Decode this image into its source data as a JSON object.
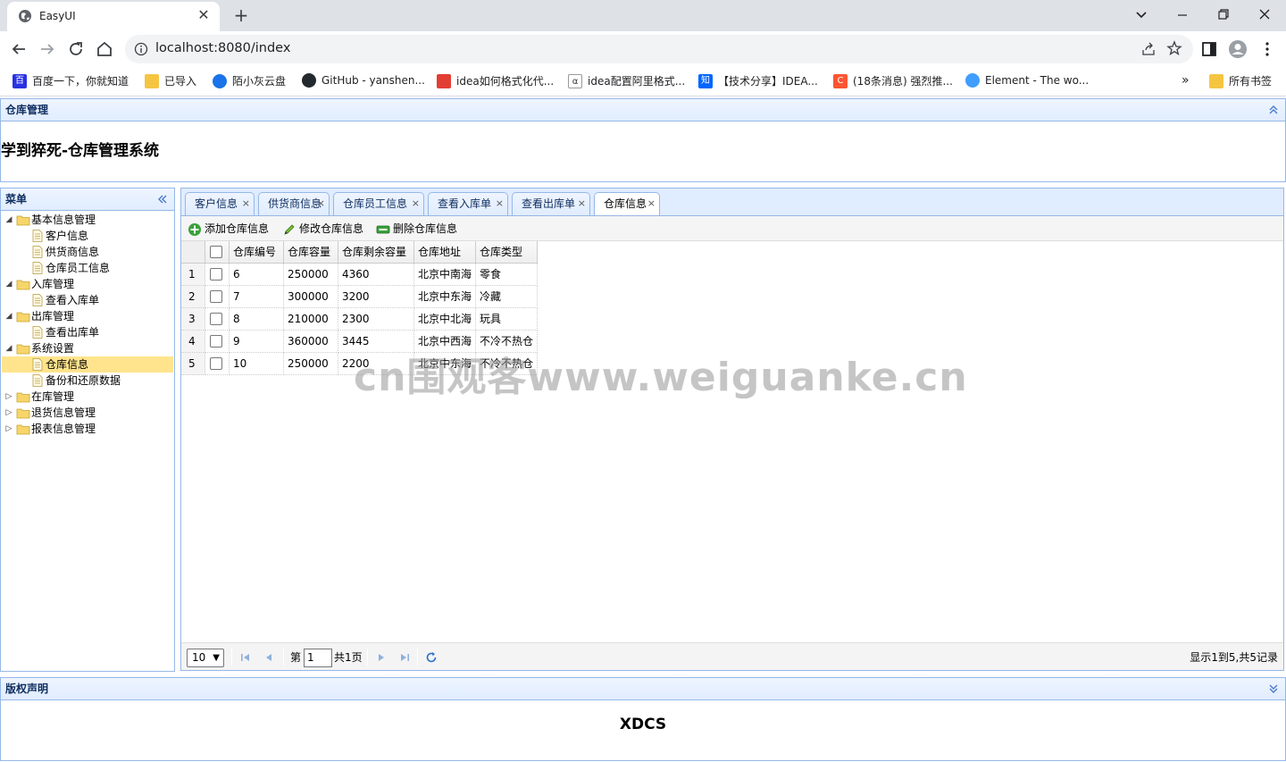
{
  "browser": {
    "tab_title": "EasyUI",
    "url": "localhost:8080/index",
    "bookmarks": [
      {
        "label": "百度一下，你就知道",
        "icon": "baidu-icon"
      },
      {
        "label": "已导入",
        "icon": "folder-icon"
      },
      {
        "label": "陌小灰云盘",
        "icon": "cloud-icon"
      },
      {
        "label": "GitHub - yanshen...",
        "icon": "github-icon"
      },
      {
        "label": "idea如何格式化代...",
        "icon": "csdn-icon"
      },
      {
        "label": "idea配置阿里格式...",
        "icon": "ali-icon"
      },
      {
        "label": "【技术分享】IDEA...",
        "icon": "zhihu-icon"
      },
      {
        "label": "(18条消息) 强烈推...",
        "icon": "csdn-c-icon"
      },
      {
        "label": "Element - The wo...",
        "icon": "element-icon"
      }
    ],
    "more_bookmarks": "»",
    "all_bookmarks": "所有书签"
  },
  "north": {
    "panel_title": "仓库管理",
    "system_title": "学到猝死-仓库管理系统"
  },
  "west": {
    "panel_title": "菜单",
    "tree": [
      {
        "label": "基本信息管理",
        "level": 0,
        "folder": true,
        "open": true
      },
      {
        "label": "客户信息",
        "level": 1,
        "folder": false
      },
      {
        "label": "供货商信息",
        "level": 1,
        "folder": false
      },
      {
        "label": "仓库员工信息",
        "level": 1,
        "folder": false
      },
      {
        "label": "入库管理",
        "level": 0,
        "folder": true,
        "open": true
      },
      {
        "label": "查看入库单",
        "level": 1,
        "folder": false
      },
      {
        "label": "出库管理",
        "level": 0,
        "folder": true,
        "open": true
      },
      {
        "label": "查看出库单",
        "level": 1,
        "folder": false
      },
      {
        "label": "系统设置",
        "level": 0,
        "folder": true,
        "open": true
      },
      {
        "label": "仓库信息",
        "level": 1,
        "folder": false,
        "selected": true
      },
      {
        "label": "备份和还原数据",
        "level": 1,
        "folder": false
      },
      {
        "label": "在库管理",
        "level": 0,
        "folder": true,
        "open": false
      },
      {
        "label": "退货信息管理",
        "level": 0,
        "folder": true,
        "open": false
      },
      {
        "label": "报表信息管理",
        "level": 0,
        "folder": true,
        "open": false
      }
    ]
  },
  "tabs": [
    {
      "label": "客户信息"
    },
    {
      "label": "供货商信息"
    },
    {
      "label": "仓库员工信息"
    },
    {
      "label": "查看入库单"
    },
    {
      "label": "查看出库单"
    },
    {
      "label": "仓库信息",
      "active": true
    }
  ],
  "tab_close": "×",
  "toolbar": {
    "add_label": "添加仓库信息",
    "edit_label": "修改仓库信息",
    "delete_label": "删除仓库信息"
  },
  "grid": {
    "columns": [
      "仓库编号",
      "仓库容量",
      "仓库剩余容量",
      "仓库地址",
      "仓库类型"
    ],
    "rows": [
      {
        "num": "1",
        "cells": [
          "6",
          "250000",
          "4360",
          "北京中南海",
          "零食"
        ]
      },
      {
        "num": "2",
        "cells": [
          "7",
          "300000",
          "3200",
          "北京中东海",
          "冷藏"
        ]
      },
      {
        "num": "3",
        "cells": [
          "8",
          "210000",
          "2300",
          "北京中北海",
          "玩具"
        ]
      },
      {
        "num": "4",
        "cells": [
          "9",
          "360000",
          "3445",
          "北京中西海",
          "不冷不热仓"
        ]
      },
      {
        "num": "5",
        "cells": [
          "10",
          "250000",
          "2200",
          "北京中东海",
          "不冷不热仓"
        ]
      }
    ]
  },
  "pager": {
    "page_size": "10",
    "page_prefix": "第",
    "page_number": "1",
    "page_suffix": "共1页",
    "info": "显示1到5,共5记录"
  },
  "watermark": "cn围观客www.weiguanke.cn",
  "south": {
    "panel_title": "版权声明",
    "footer": "XDCS"
  }
}
